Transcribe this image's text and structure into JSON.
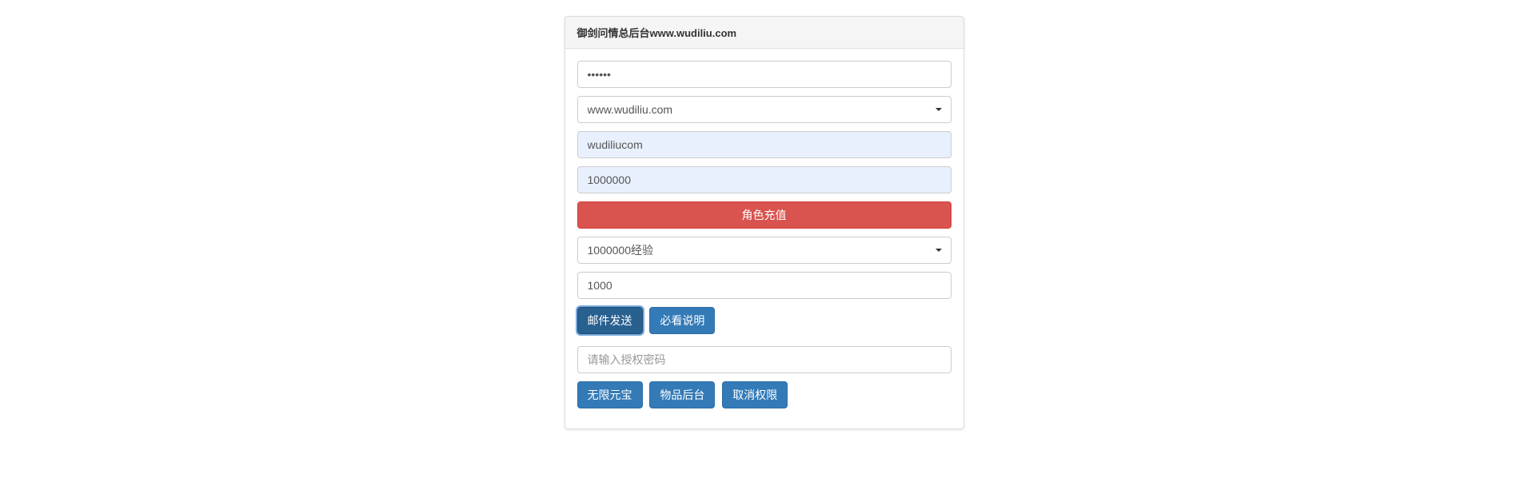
{
  "panel": {
    "title": "御剑问情总后台www.wudiliu.com"
  },
  "form": {
    "password_value": "••••••",
    "server_select": "www.wudiliu.com",
    "username_value": "wudiliucom",
    "amount_value": "1000000",
    "recharge_button": "角色充值",
    "exp_select": "1000000经验",
    "exp_amount_value": "1000",
    "send_mail_button": "邮件发送",
    "must_read_button": "必看说明",
    "auth_placeholder": "请输入授权密码",
    "unlimited_gold_button": "无限元宝",
    "item_backend_button": "物品后台",
    "cancel_auth_button": "取消权限"
  }
}
